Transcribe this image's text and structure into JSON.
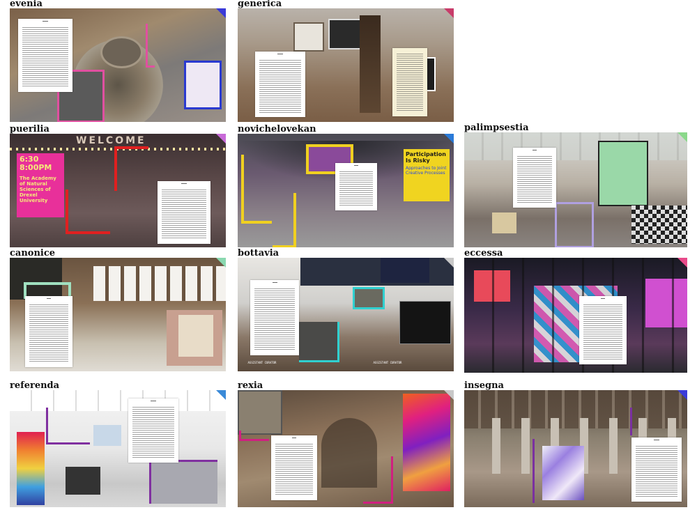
{
  "tiles": [
    {
      "name": "evenia",
      "accent": "#3a3ad8"
    },
    {
      "name": "generica",
      "accent": "#c83c6a"
    },
    {
      "name": "puerilia",
      "accent": "#c86ad8"
    },
    {
      "name": "novichelovekan",
      "accent": "#2a7ad8"
    },
    {
      "name": "palimpsestia",
      "accent": "#8ad88a"
    },
    {
      "name": "canonice",
      "accent": "#8ad8b0"
    },
    {
      "name": "bottavia",
      "accent": "#c8c8c8"
    },
    {
      "name": "eccessa",
      "accent": "#e84a8a"
    },
    {
      "name": "referenda",
      "accent": "#3a8ad8"
    },
    {
      "name": "rexia",
      "accent": "#c8c8c8"
    },
    {
      "name": "insegna",
      "accent": "#3a3ad8"
    }
  ],
  "posters": {
    "puerilia_time": "6:30 8:00PM",
    "puerilia_title": "The Academy of Natural Sciences of Drexel University",
    "novichelovekan_title": "Participation Is Risky",
    "novichelovekan_subtitle": "Approaches to Joint Creative Processes",
    "welcome_sign": "WELCOME",
    "bottavia_console_1": "ASSISTANT CURATOR",
    "bottavia_console_2": "ASSISTANT CURATOR"
  }
}
